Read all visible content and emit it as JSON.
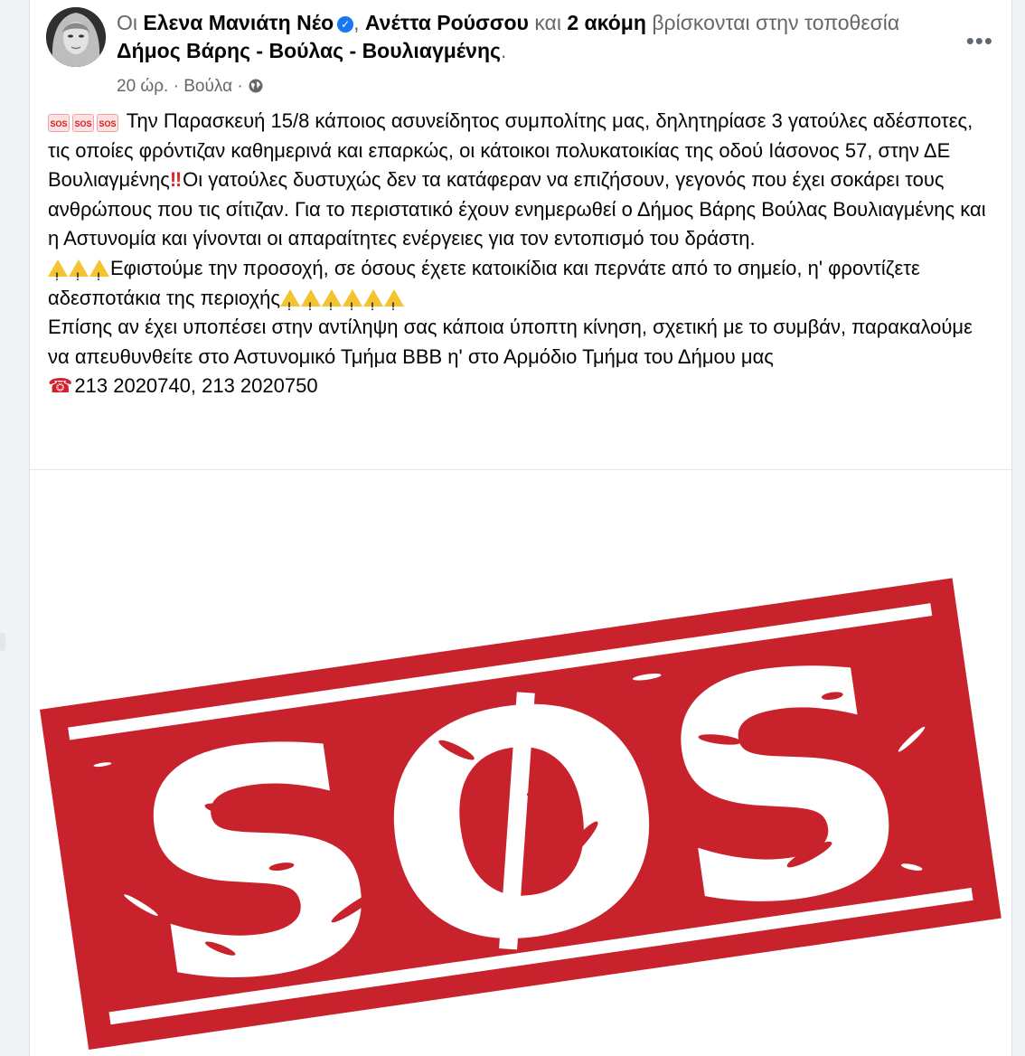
{
  "post": {
    "header": {
      "prefix": "Οι",
      "author_primary": "Ελενα Μανιάτη Νέο",
      "comma": ",",
      "author_secondary": "Ανέττα Ρούσσου",
      "and": "και",
      "others": "2 ακόμη",
      "location_text_a": "βρίσκονται στην",
      "location_text_b": "τοποθεσία",
      "location": "Δήμος Βάρης - Βούλας - Βουλιαγμένης",
      "period": "."
    },
    "meta": {
      "time": "20 ώρ.",
      "sep1": "·",
      "place": "Βούλα",
      "sep2": "·"
    },
    "more_label": "•••",
    "verified_glyph": "✓",
    "body": {
      "sos_label": "SOS",
      "p1": "Την Παρασκευή 15/8 κάποιος ασυνείδητος συμπολίτης μας, δηλητηρίασε 3 γατούλες αδέσποτες, τις οποίες φρόντιζαν καθημερινά και επαρκώς, οι κάτοικοι πολυκατοικίας της οδού Ιάσονος 57, στην ΔΕ Βουλιαγμένης",
      "p1_bang": "‼",
      "p1_cont": "Οι γατούλες δυστυχώς δεν τα κατάφεραν να επιζήσουν, γεγονός που έχει σοκάρει τους ανθρώπους που τις σίτιζαν. Για το περιστατικό έχουν ενημερωθεί ο Δήμος Βάρης Βούλας Βουλιαγμένης και  η Αστυνομία και γίνονται οι απαραίτητες ενέργειες για τον εντοπισμό του δράστη.",
      "p2": "Εφιστούμε την προσοχή, σε όσους έχετε κατοικίδια και περνάτε από το σημείο, η' φροντίζετε αδεσποτάκια της περιοχής",
      "p3": "Επίσης αν έχει υποπέσει στην αντίληψη σας κάποια ύποπτη κίνηση, σχετική με το συμβάν, παρακαλούμε να απευθυνθείτε στο Αστυνομικό Τμήμα ΒΒΒ η' στο Αρμόδιο Τμήμα του Δήμου μας",
      "phone_glyph": "☎",
      "phones": "213 2020740, 213 2020750"
    },
    "image": {
      "stamp_text": "SOS",
      "stamp_color": "#c8232c"
    }
  }
}
